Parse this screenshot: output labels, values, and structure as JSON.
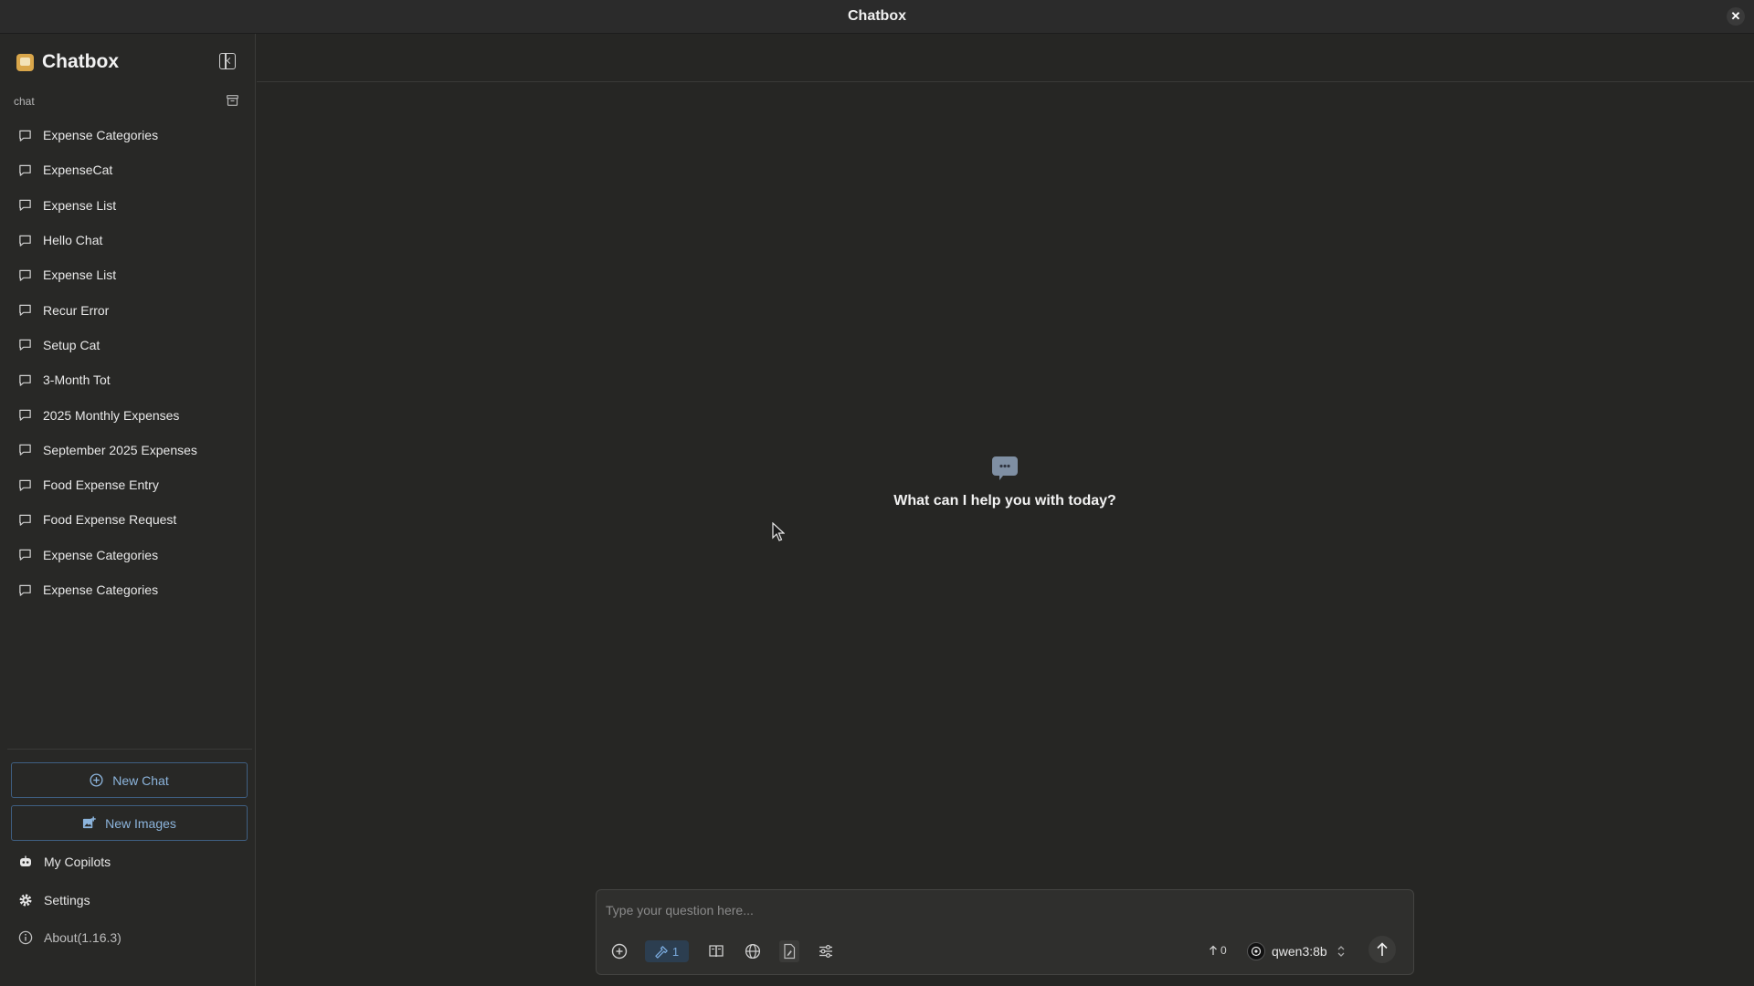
{
  "window": {
    "title": "Chatbox",
    "close_label": "✕"
  },
  "sidebar": {
    "brand": "Chatbox",
    "section_label": "chat",
    "chats": [
      "Expense Categories",
      "ExpenseCat",
      "Expense List",
      "Hello Chat",
      "Expense List",
      "Recur Error",
      "Setup Cat",
      "3-Month Tot",
      "2025 Monthly Expenses",
      "September 2025 Expenses",
      "Food Expense Entry",
      "Food Expense Request",
      "Expense Categories",
      "Expense Categories"
    ],
    "new_chat_label": "New Chat",
    "new_images_label": "New Images",
    "my_copilots_label": "My Copilots",
    "settings_label": "Settings",
    "about_label": "About(1.16.3)"
  },
  "main": {
    "empty_prompt": "What can I help you with today?"
  },
  "composer": {
    "placeholder": "Type your question here...",
    "mcp_count": "1",
    "token_count": "0",
    "model": "qwen3:8b"
  },
  "colors": {
    "accent": "#8cb4dc",
    "background": "#262624",
    "sidebar": "#282826"
  }
}
